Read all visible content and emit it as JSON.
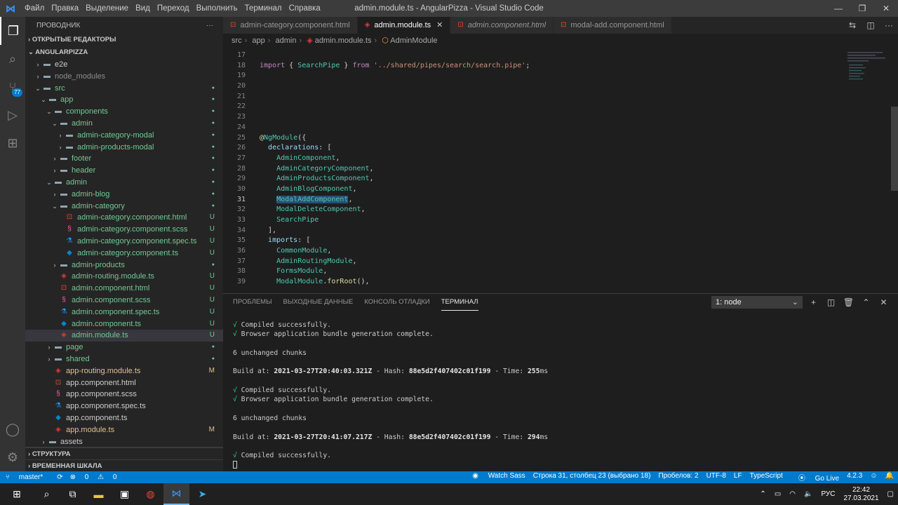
{
  "window": {
    "title": "admin.module.ts - AngularPizza - Visual Studio Code",
    "menu": [
      "Файл",
      "Правка",
      "Выделение",
      "Вид",
      "Переход",
      "Выполнить",
      "Терминал",
      "Справка"
    ]
  },
  "activity": {
    "scm_badge": "77"
  },
  "sidebar": {
    "title": "ПРОВОДНИК",
    "more": "···",
    "open_editors": "ОТКРЫТЫЕ РЕДАКТОРЫ",
    "project": "ANGULARPIZZA",
    "tree": [
      {
        "label": "e2e",
        "level": 1,
        "chev": "›",
        "icon": "folder",
        "color": "#cccccc",
        "badge": ""
      },
      {
        "label": "node_modules",
        "level": 1,
        "chev": "›",
        "icon": "folder",
        "color": "#8c8c8c",
        "badge": ""
      },
      {
        "label": "src",
        "level": 1,
        "chev": "⌄",
        "icon": "folder",
        "color": "#73c991",
        "badge": "●"
      },
      {
        "label": "app",
        "level": 2,
        "chev": "⌄",
        "icon": "folder",
        "color": "#73c991",
        "badge": "●"
      },
      {
        "label": "components",
        "level": 3,
        "chev": "⌄",
        "icon": "folder",
        "color": "#73c991",
        "badge": "●"
      },
      {
        "label": "admin",
        "level": 4,
        "chev": "⌄",
        "icon": "folder",
        "color": "#73c991",
        "badge": "●"
      },
      {
        "label": "admin-category-modal",
        "level": 5,
        "chev": "›",
        "icon": "folder",
        "color": "#73c991",
        "badge": "●"
      },
      {
        "label": "admin-products-modal",
        "level": 5,
        "chev": "›",
        "icon": "folder",
        "color": "#73c991",
        "badge": "●"
      },
      {
        "label": "footer",
        "level": 4,
        "chev": "›",
        "icon": "folder",
        "color": "#73c991",
        "badge": "●"
      },
      {
        "label": "header",
        "level": 4,
        "chev": "›",
        "icon": "folder",
        "color": "#73c991",
        "badge": "●"
      },
      {
        "label": "admin",
        "level": 3,
        "chev": "⌄",
        "icon": "folder",
        "color": "#73c991",
        "badge": "●"
      },
      {
        "label": "admin-blog",
        "level": 4,
        "chev": "›",
        "icon": "folder",
        "color": "#73c991",
        "badge": "●"
      },
      {
        "label": "admin-category",
        "level": 4,
        "chev": "⌄",
        "icon": "folder",
        "color": "#73c991",
        "badge": "●"
      },
      {
        "label": "admin-category.component.html",
        "level": 5,
        "chev": "",
        "icon": "html",
        "color": "#73c991",
        "badge": "U"
      },
      {
        "label": "admin-category.component.scss",
        "level": 5,
        "chev": "",
        "icon": "scss",
        "color": "#73c991",
        "badge": "U"
      },
      {
        "label": "admin-category.component.spec.ts",
        "level": 5,
        "chev": "",
        "icon": "spec",
        "color": "#73c991",
        "badge": "U"
      },
      {
        "label": "admin-category.component.ts",
        "level": 5,
        "chev": "",
        "icon": "ts",
        "color": "#73c991",
        "badge": "U"
      },
      {
        "label": "admin-products",
        "level": 4,
        "chev": "›",
        "icon": "folder",
        "color": "#73c991",
        "badge": "●"
      },
      {
        "label": "admin-routing.module.ts",
        "level": 4,
        "chev": "",
        "icon": "angular",
        "color": "#73c991",
        "badge": "U"
      },
      {
        "label": "admin.component.html",
        "level": 4,
        "chev": "",
        "icon": "html",
        "color": "#73c991",
        "badge": "U"
      },
      {
        "label": "admin.component.scss",
        "level": 4,
        "chev": "",
        "icon": "scss",
        "color": "#73c991",
        "badge": "U"
      },
      {
        "label": "admin.component.spec.ts",
        "level": 4,
        "chev": "",
        "icon": "spec",
        "color": "#73c991",
        "badge": "U"
      },
      {
        "label": "admin.component.ts",
        "level": 4,
        "chev": "",
        "icon": "ts",
        "color": "#73c991",
        "badge": "U"
      },
      {
        "label": "admin.module.ts",
        "level": 4,
        "chev": "",
        "icon": "angular",
        "color": "#73c991",
        "badge": "U",
        "selected": true
      },
      {
        "label": "page",
        "level": 3,
        "chev": "›",
        "icon": "folder",
        "color": "#73c991",
        "badge": "●"
      },
      {
        "label": "shared",
        "level": 3,
        "chev": "›",
        "icon": "folder",
        "color": "#73c991",
        "badge": "●"
      },
      {
        "label": "app-routing.module.ts",
        "level": 3,
        "chev": "",
        "icon": "angular",
        "color": "#e2c08d",
        "badge": "M"
      },
      {
        "label": "app.component.html",
        "level": 3,
        "chev": "",
        "icon": "html",
        "color": "#cccccc",
        "badge": ""
      },
      {
        "label": "app.component.scss",
        "level": 3,
        "chev": "",
        "icon": "scss",
        "color": "#cccccc",
        "badge": ""
      },
      {
        "label": "app.component.spec.ts",
        "level": 3,
        "chev": "",
        "icon": "spec",
        "color": "#cccccc",
        "badge": ""
      },
      {
        "label": "app.component.ts",
        "level": 3,
        "chev": "",
        "icon": "ts",
        "color": "#cccccc",
        "badge": ""
      },
      {
        "label": "app.module.ts",
        "level": 3,
        "chev": "",
        "icon": "angular",
        "color": "#e2c08d",
        "badge": "M"
      },
      {
        "label": "assets",
        "level": 2,
        "chev": "›",
        "icon": "folder",
        "color": "#cccccc",
        "badge": ""
      }
    ],
    "outline": "СТРУКТУРА",
    "timeline": "ВРЕМЕННАЯ ШКАЛА"
  },
  "tabs": [
    {
      "label": "admin-category.component.html",
      "icon": "html",
      "active": false,
      "italic": false
    },
    {
      "label": "admin.module.ts",
      "icon": "angular",
      "active": true,
      "italic": false
    },
    {
      "label": "admin.component.html",
      "icon": "html",
      "active": false,
      "italic": true
    },
    {
      "label": "modal-add.component.html",
      "icon": "html",
      "active": false,
      "italic": false
    }
  ],
  "tab_close": "✕",
  "breadcrumb": [
    "src",
    "app",
    "admin",
    "admin.module.ts",
    "AdminModule"
  ],
  "code": {
    "current_line": 31,
    "lines": [
      {
        "n": 17,
        "text": ""
      },
      {
        "n": 18,
        "text": "import { SearchPipe } from '../shared/pipes/search/search.pipe';"
      },
      {
        "n": 19,
        "text": ""
      },
      {
        "n": 20,
        "text": ""
      },
      {
        "n": 21,
        "text": ""
      },
      {
        "n": 22,
        "text": ""
      },
      {
        "n": 23,
        "text": ""
      },
      {
        "n": 24,
        "text": ""
      },
      {
        "n": 25,
        "text": "@NgModule({"
      },
      {
        "n": 26,
        "text": "  declarations: ["
      },
      {
        "n": 27,
        "text": "    AdminComponent,"
      },
      {
        "n": 28,
        "text": "    AdminCategoryComponent,"
      },
      {
        "n": 29,
        "text": "    AdminProductsComponent,"
      },
      {
        "n": 30,
        "text": "    AdminBlogComponent,"
      },
      {
        "n": 31,
        "text": "    ModalAddComponent,"
      },
      {
        "n": 32,
        "text": "    ModalDeleteComponent,"
      },
      {
        "n": 33,
        "text": "    SearchPipe"
      },
      {
        "n": 34,
        "text": "  ],"
      },
      {
        "n": 35,
        "text": "  imports: ["
      },
      {
        "n": 36,
        "text": "    CommonModule,"
      },
      {
        "n": 37,
        "text": "    AdminRoutingModule,"
      },
      {
        "n": 38,
        "text": "    FormsModule,"
      },
      {
        "n": 39,
        "text": "    ModalModule.forRoot(),"
      },
      {
        "n": 40,
        "text": ""
      }
    ]
  },
  "panel": {
    "tabs": [
      "ПРОБЛЕМЫ",
      "ВЫХОДНЫЕ ДАННЫЕ",
      "КОНСОЛЬ ОТЛАДКИ",
      "ТЕРМИНАЛ"
    ],
    "active_tab": 3,
    "terminal_select": "1: node",
    "lines": [
      {
        "kind": "ok",
        "text": "Compiled successfully."
      },
      {
        "kind": "ok",
        "text": "Browser application bundle generation complete."
      },
      {
        "kind": "blank",
        "text": ""
      },
      {
        "kind": "plain",
        "text": "6 unchanged chunks"
      },
      {
        "kind": "blank",
        "text": ""
      },
      {
        "kind": "build",
        "at": "2021-03-27T20:40:03.321Z",
        "hash": "88e5d2f407402c01f199",
        "time": "255"
      },
      {
        "kind": "blank",
        "text": ""
      },
      {
        "kind": "ok",
        "text": "Compiled successfully."
      },
      {
        "kind": "ok",
        "text": "Browser application bundle generation complete."
      },
      {
        "kind": "blank",
        "text": ""
      },
      {
        "kind": "plain",
        "text": "6 unchanged chunks"
      },
      {
        "kind": "blank",
        "text": ""
      },
      {
        "kind": "build",
        "at": "2021-03-27T20:41:07.217Z",
        "hash": "88e5d2f407402c01f199",
        "time": "294"
      },
      {
        "kind": "blank",
        "text": ""
      },
      {
        "kind": "ok",
        "text": "Compiled successfully."
      },
      {
        "kind": "cursor",
        "text": ""
      }
    ]
  },
  "status": {
    "branch": "master*",
    "errors": "0",
    "warnings": "0",
    "watch_sass": "Watch Sass",
    "position": "Строка 31, столбец 23 (выбрано 18)",
    "spaces": "Пробелов: 2",
    "encoding": "UTF-8",
    "eol": "LF",
    "language": "TypeScript",
    "go_live": "Go Live",
    "version": "4.2.3"
  },
  "taskbar": {
    "lang": "РУС",
    "time": "22:42",
    "date": "27.03.2021"
  }
}
